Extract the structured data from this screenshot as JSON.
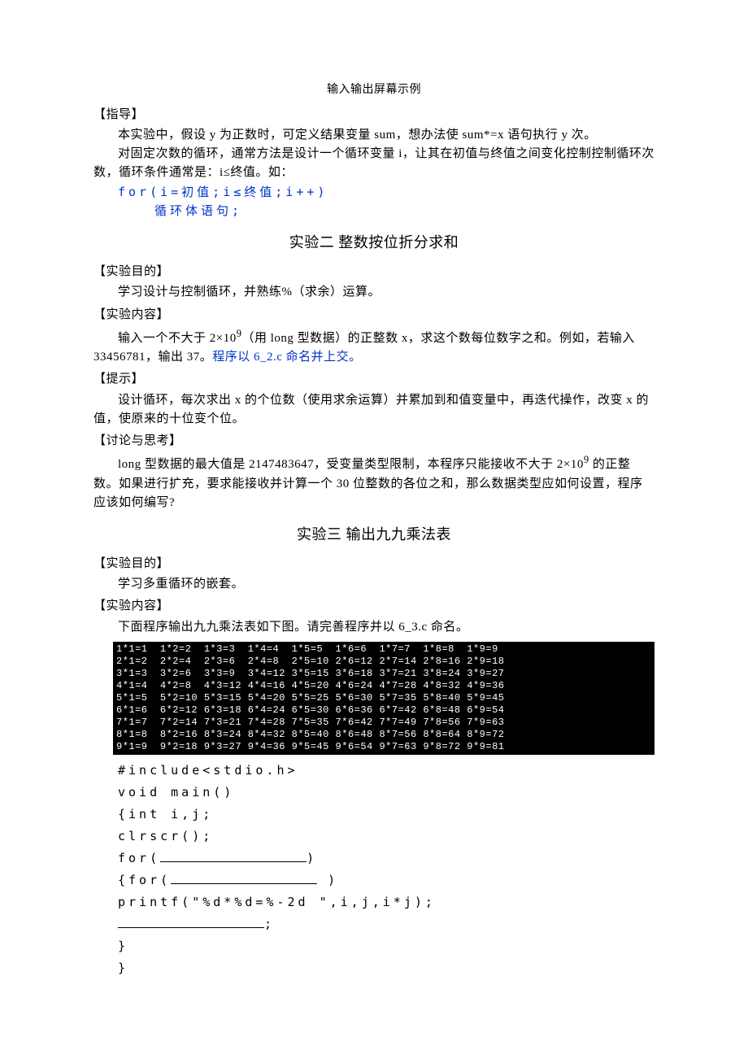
{
  "caption": "输入输出屏幕示例",
  "guide": {
    "title": "【指导】",
    "p1": "本实验中，假设 y 为正数时，可定义结果变量 sum，想办法使 sum*=x 语句执行 y 次。",
    "p2": "对固定次数的循环，通常方法是设计一个循环变量 i，让其在初值与终值之间变化控制控制循环次数，循环条件通常是：i≤终值。如：",
    "code1": "for(i=初值;i≤终值;i++)",
    "code2": "循环体语句;"
  },
  "exp2": {
    "title": "实验二  整数按位折分求和",
    "goal_h": "【实验目的】",
    "goal_p": "学习设计与控制循环，并熟练%（求余）运算。",
    "content_h": "【实验内容】",
    "content_p1a": "输入一个不大于 2×10",
    "content_p1b": "（用 long 型数据）的正整数 x，求这个数每位数字之和。例如，若输入 33456781，输出 37。",
    "content_p1c": "程序以 6_2.c 命名并上交。",
    "hint_h": "【提示】",
    "hint_p": "设计循环，每次求出 x 的个位数（使用求余运算）并累加到和值变量中，再迭代操作，改变 x 的值，使原来的十位变个位。",
    "discuss_h": "【讨论与思考】",
    "discuss_p1a": "long 型数据的最大值是 2147483647，受变量类型限制，本程序只能接收不大于 2×10",
    "discuss_p1b": " 的正整数。如果进行扩充，要求能接收并计算一个 30 位整数的各位之和，那么数据类型应如何设置，程序应该如何编写?"
  },
  "exp3": {
    "title": "实验三  输出九九乘法表",
    "goal_h": "【实验目的】",
    "goal_p": "学习多重循环的嵌套。",
    "content_h": "【实验内容】",
    "content_p": "下面程序输出九九乘法表如下图。请完善程序并以 6_3.c 命名。",
    "code": {
      "l1": "#include<stdio.h>",
      "l2": "void main()",
      "l3": "{int i,j;",
      "l4": " clrscr();",
      "l5": " for(",
      "l5b": ")",
      "l6": "  {for(",
      "l6b": " )",
      "l7": "     printf(\"%d*%d=%-2d \",i,j,i*j);",
      "l8a": "   ",
      "l8b": ";",
      "l9": "  }",
      "l10": "}"
    }
  },
  "chart_data": {
    "type": "table",
    "title": "九九乘法表",
    "rows": [
      [
        "1*1=1",
        "1*2=2",
        "1*3=3",
        "1*4=4",
        "1*5=5",
        "1*6=6",
        "1*7=7",
        "1*8=8",
        "1*9=9"
      ],
      [
        "2*1=2",
        "2*2=4",
        "2*3=6",
        "2*4=8",
        "2*5=10",
        "2*6=12",
        "2*7=14",
        "2*8=16",
        "2*9=18"
      ],
      [
        "3*1=3",
        "3*2=6",
        "3*3=9",
        "3*4=12",
        "3*5=15",
        "3*6=18",
        "3*7=21",
        "3*8=24",
        "3*9=27"
      ],
      [
        "4*1=4",
        "4*2=8",
        "4*3=12",
        "4*4=16",
        "4*5=20",
        "4*6=24",
        "4*7=28",
        "4*8=32",
        "4*9=36"
      ],
      [
        "5*1=5",
        "5*2=10",
        "5*3=15",
        "5*4=20",
        "5*5=25",
        "5*6=30",
        "5*7=35",
        "5*8=40",
        "5*9=45"
      ],
      [
        "6*1=6",
        "6*2=12",
        "6*3=18",
        "6*4=24",
        "6*5=30",
        "6*6=36",
        "6*7=42",
        "6*8=48",
        "6*9=54"
      ],
      [
        "7*1=7",
        "7*2=14",
        "7*3=21",
        "7*4=28",
        "7*5=35",
        "7*6=42",
        "7*7=49",
        "7*8=56",
        "7*9=63"
      ],
      [
        "8*1=8",
        "8*2=16",
        "8*3=24",
        "8*4=32",
        "8*5=40",
        "8*6=48",
        "8*7=56",
        "8*8=64",
        "8*9=72"
      ],
      [
        "9*1=9",
        "9*2=18",
        "9*3=27",
        "9*4=36",
        "9*5=45",
        "9*6=54",
        "9*7=63",
        "9*8=72",
        "9*9=81"
      ]
    ]
  }
}
